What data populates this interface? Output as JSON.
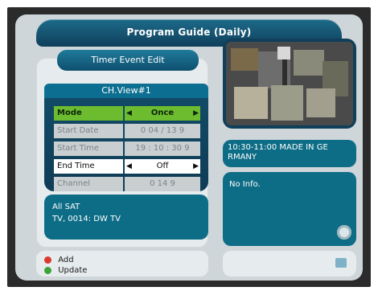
{
  "header": {
    "title": "Program Guide (Daily)"
  },
  "panel": {
    "tab": "Timer Event Edit",
    "channel_view": "CH.View#1"
  },
  "form": {
    "rows": [
      {
        "label": "Mode",
        "value": "Once",
        "state": "active",
        "has_arrows": true
      },
      {
        "label": "Start Date",
        "value": "0 04 / 13 9",
        "state": "disabled",
        "has_arrows": false
      },
      {
        "label": "Start Time",
        "value": "19 : 10 : 30 9",
        "state": "disabled",
        "has_arrows": false
      },
      {
        "label": "End Time",
        "value": "Off",
        "state": "selected",
        "has_arrows": true
      },
      {
        "label": "Channel",
        "value": "0 14 9",
        "state": "disabled",
        "has_arrows": false
      }
    ]
  },
  "info": {
    "line1": "All SAT",
    "line2": "TV, 0014: DW TV"
  },
  "legend": [
    {
      "color": "#d83a2f",
      "label": "Add"
    },
    {
      "color": "#3ba33a",
      "label": "Update"
    }
  ],
  "program": {
    "time_title": "10:30-11:00 MADE IN GE RMANY"
  },
  "description": {
    "text": "No Info."
  },
  "icons": {
    "disc": "disc-icon",
    "dots": [
      "red-dot-icon",
      "green-dot-icon"
    ]
  },
  "colors": {
    "accent": "#0e6d86",
    "title_bar": "#1d6b8a",
    "active_row": "#6dbb2f"
  }
}
